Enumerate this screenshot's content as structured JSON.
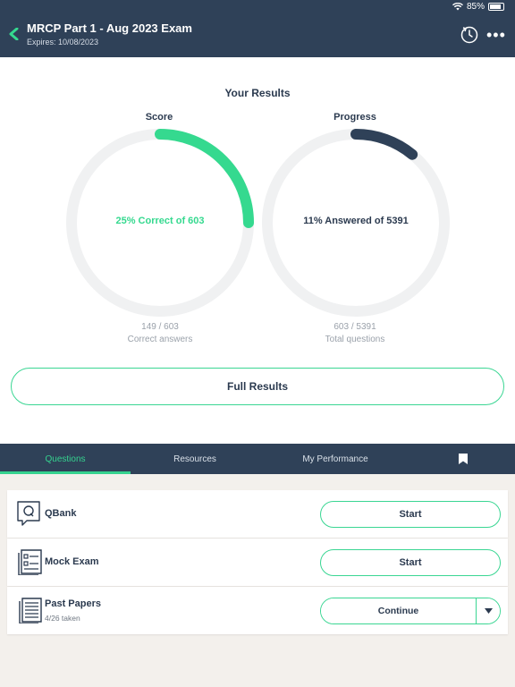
{
  "status_bar": {
    "battery": "85%"
  },
  "header": {
    "title": "MRCP Part 1 - Aug 2023 Exam",
    "expires": "Expires: 10/08/2023"
  },
  "results": {
    "heading": "Your Results",
    "score": {
      "label": "Score",
      "center": "25% Correct of 603",
      "fraction": "149 / 603",
      "caption": "Correct answers",
      "percent": 25,
      "color": "#35d98f"
    },
    "progress": {
      "label": "Progress",
      "center": "11% Answered of 5391",
      "fraction": "603 / 5391",
      "caption": "Total questions",
      "percent": 11,
      "color": "#2f4158"
    },
    "full_results": "Full Results"
  },
  "tabs": [
    {
      "label": "Questions"
    },
    {
      "label": "Resources"
    },
    {
      "label": "My Performance"
    },
    {
      "icon": "bookmark-icon"
    }
  ],
  "items": [
    {
      "name": "QBank",
      "action": "Start"
    },
    {
      "name": "Mock Exam",
      "action": "Start"
    },
    {
      "name": "Past Papers",
      "meta": "4/26 taken",
      "action": "Continue"
    }
  ],
  "colors": {
    "accent": "#35d98f",
    "navy": "#2f4158",
    "track": "#f0f1f2"
  }
}
